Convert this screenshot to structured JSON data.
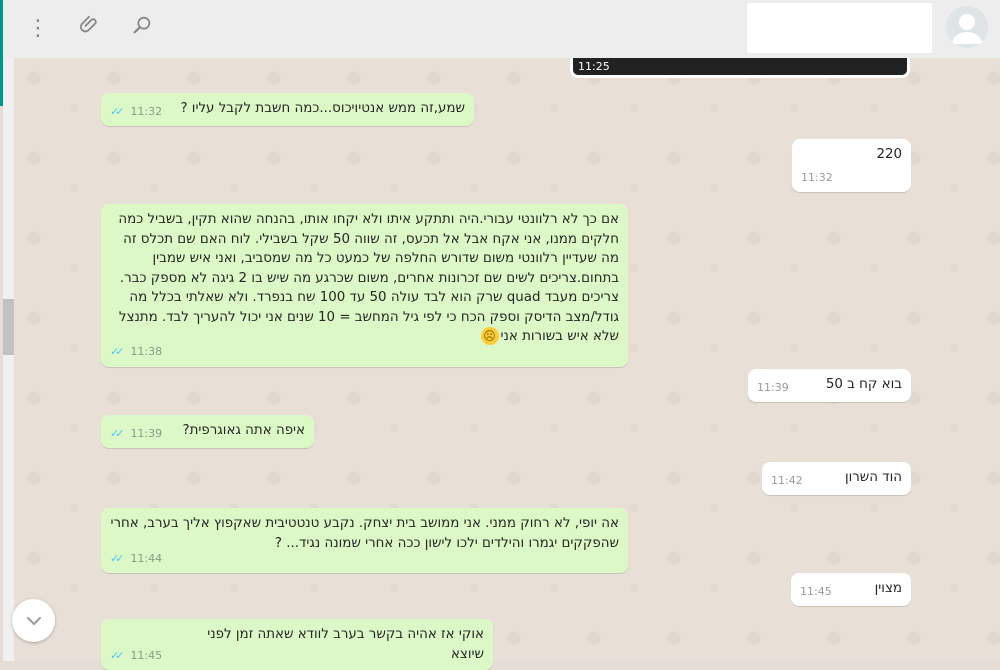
{
  "header": {
    "menu_icon": "⋮",
    "attach_icon": "📎",
    "search_icon": "⌕"
  },
  "media": {
    "time": "11:25"
  },
  "messages": [
    {
      "dir": "out",
      "text": "שמע,זה ממש אנטיויכוס...כמה חשבת לקבל עליו ?",
      "time": "11:32"
    },
    {
      "dir": "in",
      "text": "220",
      "time": "11:32"
    },
    {
      "dir": "out",
      "text": "אם כך לא רלוונטי עבורי.היה ותתקע איתו ולא יקחו אותו, בהנחה שהוא תקין, בשביל כמה חלקים ממנו, אני אקח אבל אל תכעס, זה שווה 50 שקל בשבילי. לוח האם שם תכלס זה מה שעדיין רלוונטי משום שדורש החלפה של כמעט כל מה שמסביב, ואני איש שמבין בתחום.צריכים לשים שם זכרונות אחרים, משום שכרגע מה שיש בו 2 גיגה לא מספק כבר. צריכים מעבד quad שרק הוא לבד עולה 50 עד 100 שח בנפרד. ולא שאלתי בכלל מה גודל/מצב הדיסק וספק הכח  כי לפי גיל המחשב = 10 שנים אני יכול להעריך לבד. מתנצל שלא איש בשורות אני",
      "time": "11:38"
    },
    {
      "dir": "in",
      "text": "בוא קח ב 50",
      "time": "11:39"
    },
    {
      "dir": "out",
      "text": "איפה אתה גאוגרפית?",
      "time": "11:39"
    },
    {
      "dir": "in",
      "text": "הוד השרון",
      "time": "11:42"
    },
    {
      "dir": "out",
      "text": "אה יופי, לא רחוק ממני. אני ממושב בית יצחק. נקבע טנטטיבית שאקפוץ אליך בערב, אחרי שהפקקים יגמרו והילדים ילכו לישון ככה אחרי שמונה נגיד... ?",
      "time": "11:44"
    },
    {
      "dir": "in",
      "text": "מצוין",
      "time": "11:45"
    },
    {
      "dir": "out",
      "text": "אוקי אז אהיה בקשר בערב לוודא שאתה זמן לפני שיוצא",
      "time": "11:45"
    }
  ],
  "emoji_name": "slightly-frowning-face",
  "colors": {
    "outgoing": "#dcf8c6",
    "incoming": "#ffffff",
    "ticks": "#4fc3f7",
    "accent": "#009688"
  }
}
